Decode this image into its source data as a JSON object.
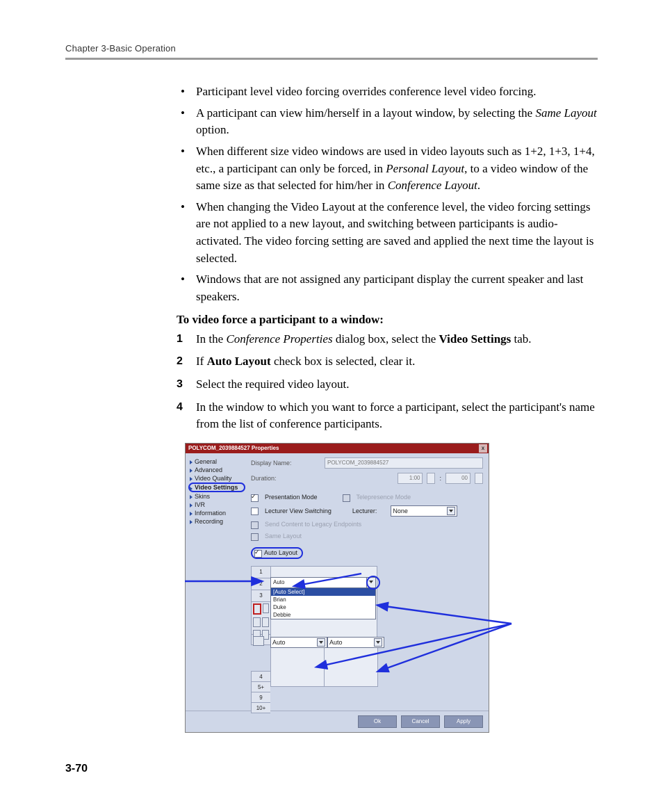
{
  "header": {
    "chapter": "Chapter 3-Basic Operation"
  },
  "bullets": [
    {
      "pre": "Participant level video forcing overrides conference level video forcing."
    },
    {
      "pre": "A participant can view him/herself in a layout window, by selecting the ",
      "em1": "Same Layout",
      "post1": " option."
    },
    {
      "pre": "When different size video windows are used in video layouts such as 1+2, 1+3, 1+4, etc., a participant can only be forced, in ",
      "em1": "Personal Layout",
      "mid": ", to a video window of the same size as that selected for him/her in ",
      "em2": "Conference Layout",
      "post2": "."
    },
    {
      "pre": "When changing the Video Layout at the conference level, the video forcing settings are not applied to a new layout, and switching between participants is audio-activated. The video forcing setting are saved and applied the next time the layout is selected."
    },
    {
      "pre": "Windows that are not assigned any participant display the current speaker and last speakers."
    }
  ],
  "subhead": "To video force a participant to a window:",
  "steps": [
    {
      "n": "1",
      "t1": "In the ",
      "em": "Conference Properties",
      "t2": " dialog box, select the ",
      "b": "Video Settings",
      "t3": " tab."
    },
    {
      "n": "2",
      "t1": "If ",
      "b": "Auto Layout",
      "t2": " check box is selected, clear it."
    },
    {
      "n": "3",
      "t1": "Select the required video layout."
    },
    {
      "n": "4",
      "t1": "In the window to which you want to force a participant, select the participant's name from the list of conference participants."
    }
  ],
  "dialog": {
    "title": "POLYCOM_2039884527 Properties",
    "close": "x",
    "sidebar": [
      "General",
      "Advanced",
      "Video Quality",
      "Video Settings",
      "Skins",
      "IVR",
      "Information",
      "Recording"
    ],
    "labels": {
      "displayName": "Display Name:",
      "displayValue": "POLYCOM_2039884527",
      "duration": "Duration:",
      "durH": "1:00",
      "durSep": ":",
      "durM": "00",
      "presentation": "Presentation Mode",
      "telepresence": "Telepresence Mode",
      "lecturerView": "Lecturer View Switching",
      "lecturer": "Lecturer:",
      "lecturerVal": "None",
      "sendContent": "Send Content to Legacy Endpoints",
      "sameLayout": "Same Layout",
      "autoLayout": "Auto Layout"
    },
    "tabs": [
      "1",
      "2",
      "3"
    ],
    "tabsBottom": [
      "4",
      "5+",
      "9",
      "10+"
    ],
    "dropdown": {
      "value": "Auto",
      "options": [
        "[Auto Select]",
        "Brian",
        "Duke",
        "Debbie"
      ]
    },
    "lowerLeft": "Auto",
    "lowerRight": "Auto",
    "buttons": {
      "ok": "Ok",
      "cancel": "Cancel",
      "apply": "Apply"
    }
  },
  "pageNumber": "3-70"
}
